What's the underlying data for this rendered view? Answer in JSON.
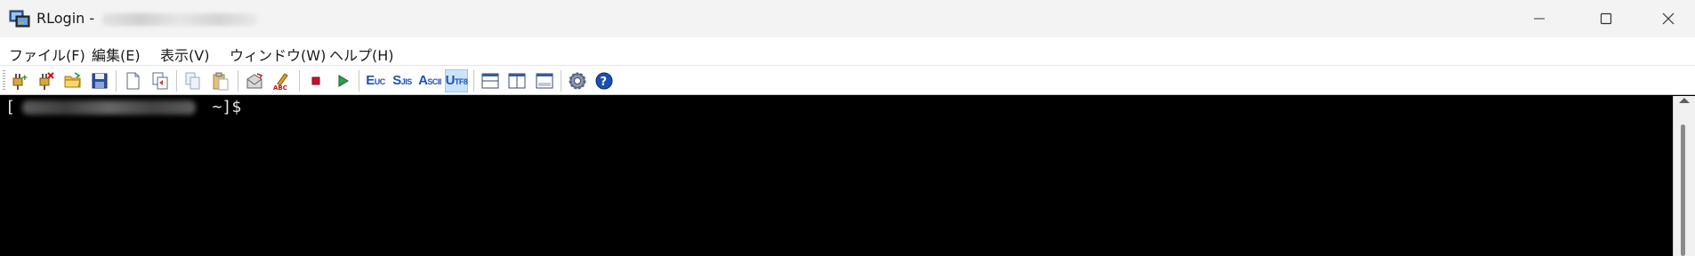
{
  "window": {
    "title": "RLogin -",
    "controls": {
      "minimize": "minimize-icon",
      "maximize": "maximize-icon",
      "close": "close-icon"
    }
  },
  "menu": {
    "items": [
      {
        "label": "ファイル(F)"
      },
      {
        "label": "編集(E)"
      },
      {
        "label": "表示(V)"
      },
      {
        "label": "ウィンドウ(W)"
      },
      {
        "label": "ヘルプ(H)"
      }
    ]
  },
  "toolbar": {
    "buttons": [
      {
        "icon": "connect-icon"
      },
      {
        "icon": "disconnect-icon"
      },
      {
        "icon": "open-folder-icon"
      },
      {
        "icon": "save-icon"
      },
      {
        "icon": "new-document-icon"
      },
      {
        "icon": "duplicate-window-icon"
      },
      {
        "icon": "copy-icon"
      },
      {
        "icon": "paste-icon"
      },
      {
        "icon": "mail-icon"
      },
      {
        "icon": "spellcheck-icon"
      },
      {
        "icon": "stop-icon"
      },
      {
        "icon": "play-icon"
      },
      {
        "icon": "euc-encoding-icon"
      },
      {
        "icon": "sjis-encoding-icon"
      },
      {
        "icon": "ascii-encoding-icon"
      },
      {
        "icon": "utf8-encoding-icon",
        "active": true
      },
      {
        "icon": "split-horizontal-icon"
      },
      {
        "icon": "split-vertical-icon"
      },
      {
        "icon": "split-panel-icon"
      },
      {
        "icon": "settings-gear-icon"
      },
      {
        "icon": "help-icon"
      }
    ],
    "encodings": {
      "euc": {
        "big": "E",
        "small": "UC"
      },
      "sjis": {
        "big": "S",
        "small": "JIS"
      },
      "ascii": {
        "big": "A",
        "small": "SCII"
      },
      "utf8": {
        "big": "U",
        "small": "TF8"
      }
    }
  },
  "terminal": {
    "prompt_open": "[",
    "prompt_close": " ~]$",
    "background": "#000000",
    "foreground": "#e8e8e8"
  },
  "colors": {
    "titlebar": "#f3f3f3",
    "toolbar_active": "#cce4f7",
    "encoding_text": "#1c54b4"
  }
}
